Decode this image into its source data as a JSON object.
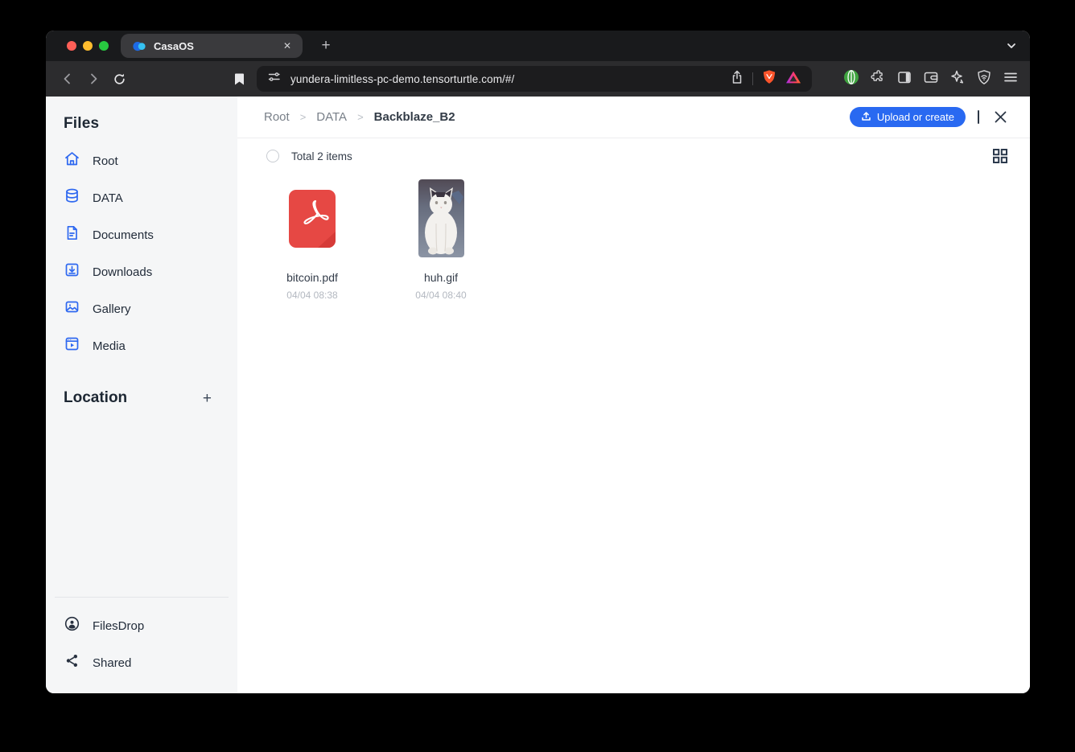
{
  "window": {
    "tab_title": "CasaOS",
    "tab_close_glyph": "✕",
    "new_tab_glyph": "+",
    "url": "yundera-limitless-pc-demo.tensorturtle.com/#/"
  },
  "sidebar": {
    "files_heading": "Files",
    "items": [
      {
        "label": "Root",
        "icon": "home-icon"
      },
      {
        "label": "DATA",
        "icon": "database-icon"
      },
      {
        "label": "Documents",
        "icon": "document-icon"
      },
      {
        "label": "Downloads",
        "icon": "download-icon"
      },
      {
        "label": "Gallery",
        "icon": "gallery-icon"
      },
      {
        "label": "Media",
        "icon": "media-icon"
      }
    ],
    "location_heading": "Location",
    "add_label": "+",
    "bottom_items": [
      {
        "label": "FilesDrop",
        "icon": "filesdrop-icon"
      },
      {
        "label": "Shared",
        "icon": "share-icon"
      }
    ]
  },
  "main": {
    "breadcrumb": {
      "items": [
        "Root",
        "DATA",
        "Backblaze_B2"
      ],
      "separator": ">"
    },
    "upload_button_label": "Upload or create",
    "total_label": "Total 2 items",
    "files": [
      {
        "name": "bitcoin.pdf",
        "date": "04/04 08:38",
        "kind": "pdf"
      },
      {
        "name": "huh.gif",
        "date": "04/04 08:40",
        "kind": "gif"
      }
    ]
  },
  "colors": {
    "accent_blue": "#2969f1",
    "sidebar_icon_blue": "#2e68f0",
    "pdf_red": "#e64844",
    "traffic_red": "#ff5f57",
    "traffic_yellow": "#febc2e",
    "traffic_green": "#28c840",
    "brave_orange": "#fb542b"
  }
}
